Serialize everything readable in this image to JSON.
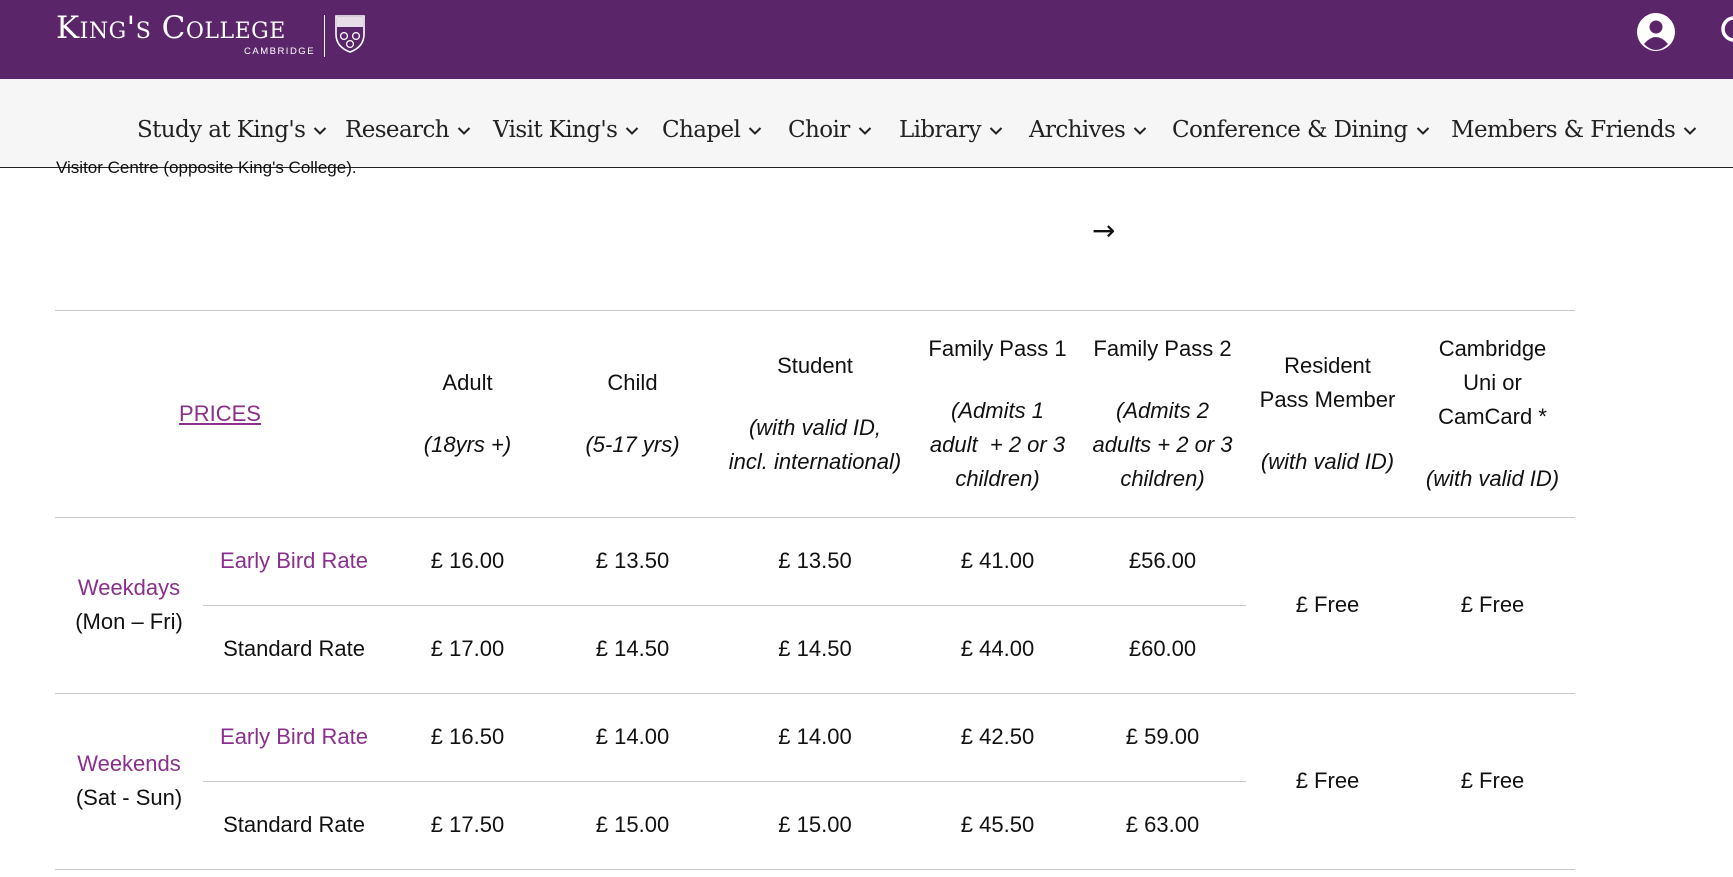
{
  "header": {
    "logo_name": "King's College",
    "logo_sub": "CAMBRIDGE",
    "account_icon": "account-icon",
    "search_icon": "search-icon",
    "background": "#5b2669"
  },
  "nav": {
    "items": [
      {
        "label": "Study at King's"
      },
      {
        "label": "Research"
      },
      {
        "label": "Visit King's"
      },
      {
        "label": "Chapel"
      },
      {
        "label": "Choir"
      },
      {
        "label": "Library"
      },
      {
        "label": "Archives"
      },
      {
        "label": "Conference & Dining"
      },
      {
        "label": "Members & Friends"
      }
    ]
  },
  "page": {
    "visitor_text": "Visitor Centre (opposite King's College).",
    "arrow": "→"
  },
  "table": {
    "prices_link": "PRICES",
    "columns": [
      {
        "label": "Adult",
        "sub": "(18yrs +)"
      },
      {
        "label": "Child",
        "sub": "(5-17 yrs)"
      },
      {
        "label": "Student",
        "sub_lines": [
          "(with valid ID,",
          "incl. international)"
        ]
      },
      {
        "label": "Family Pass 1",
        "sub_lines": [
          "(Admits 1",
          "adult  + 2 or 3",
          "children)"
        ]
      },
      {
        "label": "Family Pass 2",
        "sub_lines": [
          "(Admits 2",
          "adults + 2 or 3",
          "children)"
        ]
      },
      {
        "label_lines": [
          "Resident",
          "Pass Member"
        ],
        "sub": "(with valid ID)"
      },
      {
        "label_lines": [
          "Cambridge",
          "Uni or",
          "CamCard *"
        ],
        "sub": "(with valid ID)"
      }
    ],
    "groups": [
      {
        "name": "Weekdays",
        "days": "(Mon – Fri)",
        "rows": [
          {
            "rate": "Early Bird Rate",
            "prices": [
              "£ 16.00",
              "£ 13.50",
              "£ 13.50",
              "£ 41.00",
              "£56.00"
            ]
          },
          {
            "rate": "Standard Rate",
            "prices": [
              "£ 17.00",
              "£ 14.50",
              "£ 14.50",
              "£ 44.00",
              "£60.00"
            ]
          }
        ],
        "resident": "£ Free",
        "camcard": "£ Free"
      },
      {
        "name": "Weekends",
        "days": "(Sat - Sun)",
        "rows": [
          {
            "rate": "Early Bird Rate",
            "prices": [
              "£ 16.50",
              "£ 14.00",
              "£ 14.00",
              "£ 42.50",
              "£ 59.00"
            ]
          },
          {
            "rate": "Standard Rate",
            "prices": [
              "£ 17.50",
              "£ 15.00",
              "£ 15.00",
              "£ 45.50",
              "£ 63.00"
            ]
          }
        ],
        "resident": "£ Free",
        "camcard": "£ Free"
      }
    ],
    "accent_color": "#8b2f8c"
  }
}
